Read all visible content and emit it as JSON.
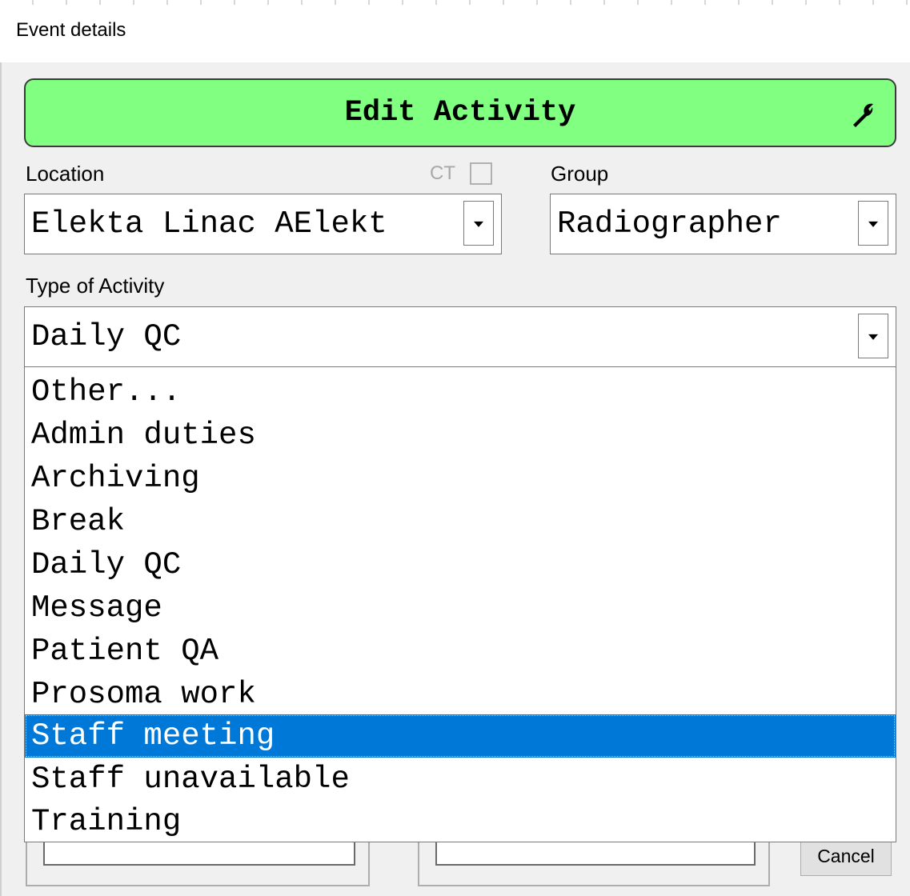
{
  "window": {
    "title": "Event details"
  },
  "header": {
    "label": "Edit Activity",
    "icon": "wrench-icon",
    "color": "#80ff80"
  },
  "location": {
    "label": "Location",
    "value": "Elekta Linac AElekt",
    "ct_label": "CT",
    "ct_checked": false
  },
  "group": {
    "label": "Group",
    "value": "Radiographer"
  },
  "activity": {
    "label": "Type of Activity",
    "value": "Daily QC",
    "options": [
      "Other...",
      "Admin duties",
      "Archiving",
      "Break",
      "Daily QC",
      "Message",
      "Patient QA",
      "Prosoma work",
      "Staff meeting",
      "Staff unavailable",
      "Training"
    ],
    "highlighted": "Staff meeting"
  },
  "buttons": {
    "cancel": "Cancel"
  },
  "colors": {
    "highlight": "#0078d7",
    "background": "#f0f0f0"
  }
}
